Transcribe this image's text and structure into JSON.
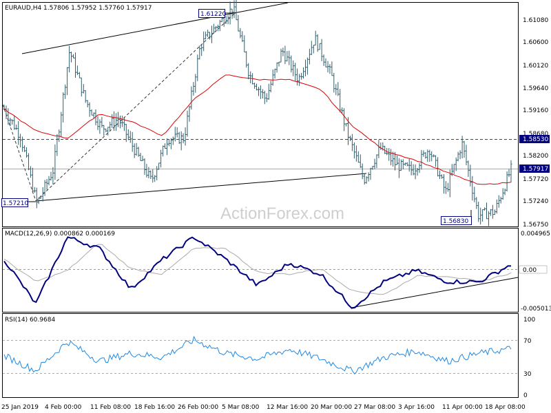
{
  "symbol_header": "EURAUD,H4  1.57806 1.57952 1.57760 1.57917",
  "watermark": "ActionForex.com",
  "colors": {
    "price": "#2f5f6e",
    "ma": "#dd0000",
    "macd": "#000080",
    "rsi": "#1e88e5",
    "grid_dash": "#999999",
    "box_bg": "#000080"
  },
  "price_axis_labels": [
    "1.61080",
    "1.60600",
    "1.60120",
    "1.59640",
    "1.59160",
    "1.58680",
    "1.58200",
    "1.57720",
    "1.57240",
    "1.56750"
  ],
  "price_markers": {
    "current": "1.57917",
    "resistance": "1.58530"
  },
  "price_annotations": {
    "high": "1.61220",
    "low_left": "1.57210",
    "low_right": "1.56830"
  },
  "macd_title": "MACD(12,26,9) 0.000862 0.000169",
  "macd_axis_labels": {
    "top": "0.004965",
    "zero": "0.00",
    "bottom": "-0.005013"
  },
  "rsi_title": "RSI(14) 60.9684",
  "rsi_axis_labels": {
    "top": "100",
    "upper": "70",
    "lower": "30",
    "bottom": "0"
  },
  "time_labels": [
    "25 Jan 2019",
    "4 Feb 00:00",
    "11 Feb 08:00",
    "18 Feb 16:00",
    "26 Feb 00:00",
    "5 Mar 08:00",
    "12 Mar 16:00",
    "20 Mar 00:00",
    "27 Mar 08:00",
    "3 Apr 16:00",
    "11 Apr 00:00",
    "18 Apr 08:00"
  ],
  "chart_data": {
    "type": "line",
    "title": "EURAUD,H4",
    "series": [
      {
        "name": "EURAUD",
        "x": [
          "25 Jan",
          "28 Jan",
          "30 Jan",
          "1 Feb",
          "4 Feb",
          "6 Feb",
          "8 Feb",
          "11 Feb",
          "14 Feb",
          "18 Feb",
          "21 Feb",
          "25 Feb",
          "28 Feb",
          "4 Mar",
          "5 Mar",
          "7 Mar",
          "11 Mar",
          "14 Mar",
          "18 Mar",
          "20 Mar",
          "22 Mar",
          "26 Mar",
          "27 Mar",
          "29 Mar",
          "2 Apr",
          "4 Apr",
          "8 Apr",
          "10 Apr",
          "12 Apr",
          "15 Apr",
          "17 Apr",
          "19 Apr"
        ],
        "values": [
          1.5915,
          1.586,
          1.5721,
          1.579,
          1.6035,
          1.593,
          1.5875,
          1.5895,
          1.583,
          1.5768,
          1.5855,
          1.5855,
          1.6045,
          1.6085,
          1.6122,
          1.5985,
          1.5935,
          1.6035,
          1.5975,
          1.606,
          1.5985,
          1.5865,
          1.577,
          1.5835,
          1.58,
          1.579,
          1.5835,
          1.5745,
          1.5845,
          1.5698,
          1.5705,
          1.5792
        ]
      },
      {
        "name": "MA",
        "x": [
          "25 Jan",
          "30 Jan",
          "4 Feb",
          "8 Feb",
          "14 Feb",
          "21 Feb",
          "28 Feb",
          "5 Mar",
          "11 Mar",
          "18 Mar",
          "22 Mar",
          "27 Mar",
          "2 Apr",
          "8 Apr",
          "12 Apr",
          "17 Apr",
          "19 Apr"
        ],
        "values": [
          1.5915,
          1.587,
          1.5855,
          1.5905,
          1.589,
          1.586,
          1.5935,
          1.5985,
          1.5975,
          1.5975,
          1.5955,
          1.588,
          1.583,
          1.581,
          1.5785,
          1.576,
          1.5765
        ]
      },
      {
        "name": "MACD(12,26,9)",
        "x": [
          "25 Jan",
          "30 Jan",
          "4 Feb",
          "8 Feb",
          "14 Feb",
          "21 Feb",
          "28 Feb",
          "5 Mar",
          "11 Mar",
          "18 Mar",
          "22 Mar",
          "27 Mar",
          "2 Apr",
          "8 Apr",
          "12 Apr",
          "17 Apr",
          "19 Apr"
        ],
        "values": [
          0.0015,
          -0.0045,
          0.0045,
          0.003,
          -0.0025,
          0.0015,
          0.0045,
          0.0015,
          -0.002,
          0.001,
          -0.0005,
          -0.005,
          -0.0015,
          0.0,
          -0.0015,
          -0.0015,
          0.0008
        ]
      },
      {
        "name": "RSI(14)",
        "x": [
          "25 Jan",
          "30 Jan",
          "4 Feb",
          "8 Feb",
          "14 Feb",
          "21 Feb",
          "28 Feb",
          "5 Mar",
          "11 Mar",
          "18 Mar",
          "22 Mar",
          "27 Mar",
          "2 Apr",
          "8 Apr",
          "12 Apr",
          "17 Apr",
          "19 Apr"
        ],
        "values": [
          52,
          33,
          70,
          45,
          55,
          50,
          72,
          55,
          48,
          60,
          48,
          32,
          50,
          58,
          45,
          55,
          61
        ]
      }
    ],
    "xlabel": "",
    "ylabel": "",
    "ylim": [
      1.5675,
      1.6132
    ],
    "grid": false
  }
}
